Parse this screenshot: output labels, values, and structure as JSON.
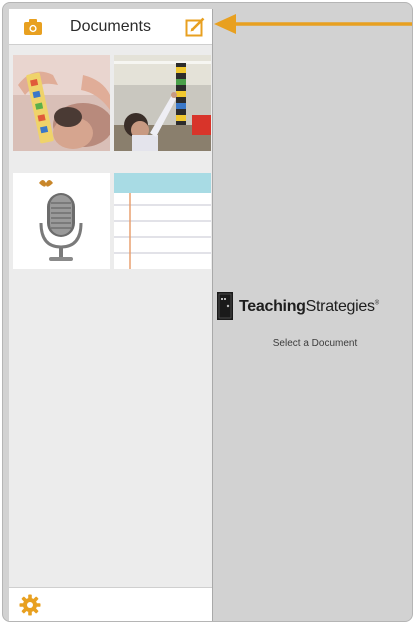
{
  "sidebar": {
    "title": "Documents",
    "documents": [
      {
        "kind": "photo",
        "subject": "child-with-ruler"
      },
      {
        "kind": "photo",
        "subject": "child-with-block-tower"
      },
      {
        "kind": "audio",
        "subject": "microphone"
      },
      {
        "kind": "note",
        "subject": "lined-paper"
      }
    ]
  },
  "detail": {
    "brand": {
      "name_bold": "Teaching",
      "name_regular": "Strategies",
      "mark": "®"
    },
    "hint": "Select a Document"
  },
  "icons": {
    "camera": "camera-icon",
    "compose": "compose-icon",
    "settings": "gear-icon",
    "logo": "book-logo-icon"
  },
  "colors": {
    "accent": "#e8a020",
    "sidebar_bg": "#ececec",
    "detail_bg": "#d2d2d2"
  }
}
